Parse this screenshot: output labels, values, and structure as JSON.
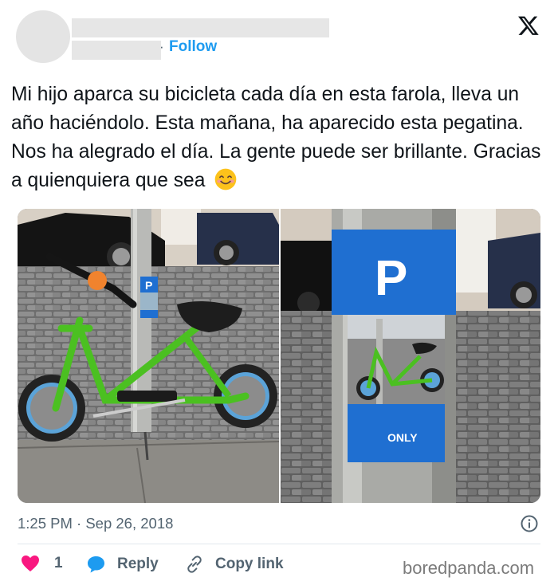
{
  "header": {
    "follow_label": "Follow",
    "dot": "·"
  },
  "tweet": {
    "text": "Mi hijo aparca su bicicleta cada día en esta farola, lleva un año haciéndolo. Esta mañana, ha aparecido esta pegatina. Nos ha alegrado el día. La gente puede ser brillante. Gracias a quienquiera que sea",
    "emoji": "smiling-face-emoji",
    "timestamp": "1:25 PM · Sep 26, 2018"
  },
  "media": {
    "left_image": "photo-green-balance-bike-locked-to-lamppost",
    "right_image": "photo-parking-sticker-on-lamppost",
    "sticker_letter": "P",
    "sticker_text": "ONLY"
  },
  "actions": {
    "like_count": "1",
    "reply_label": "Reply",
    "copy_label": "Copy link"
  },
  "watermark": "boredpanda.com",
  "colors": {
    "accent": "#1d9bf0",
    "like": "#f91880",
    "muted": "#536471",
    "sticker_blue": "#1f6fd1"
  }
}
